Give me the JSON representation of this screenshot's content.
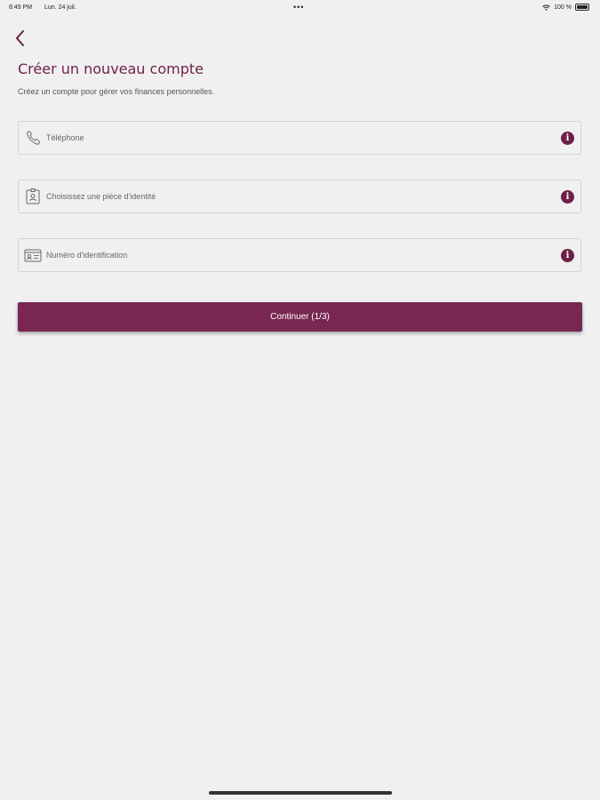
{
  "status_bar": {
    "time": "8:49 PM",
    "date": "Lun. 24 juil.",
    "dots": "•••",
    "battery": "100 %"
  },
  "header": {
    "back_icon": "chevron-left-icon",
    "title": "Créer un nouveau compte",
    "subtitle": "Créez un compte pour gérer vos finances personnelles."
  },
  "form": {
    "fields": [
      {
        "label": "Téléphone",
        "icon": "phone-icon"
      },
      {
        "label": "Choisissez une pièce d'identité",
        "icon": "id-badge-icon"
      },
      {
        "label": "Numéro d'identification",
        "icon": "id-card-icon"
      }
    ],
    "info_icon": "info-icon",
    "continue_label": "Continuer (1/3)"
  },
  "colors": {
    "accent": "#772752",
    "title": "#6e1f47",
    "background": "#f0f0f0"
  }
}
